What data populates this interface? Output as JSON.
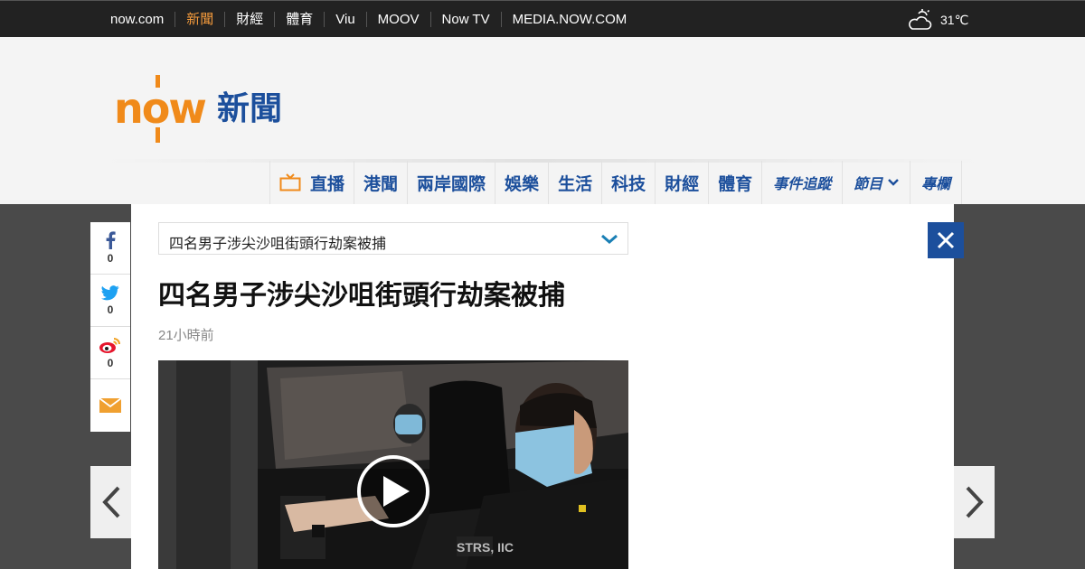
{
  "topnav": {
    "items": [
      "now.com",
      "新聞",
      "財經",
      "體育",
      "Viu",
      "MOOV",
      "Now TV",
      "MEDIA.NOW.COM"
    ]
  },
  "weather": {
    "icon": "cloudy-icon",
    "temp": "31℃"
  },
  "logo": {
    "brand": "now",
    "section": "新聞"
  },
  "mainnav": {
    "items": [
      "直播",
      "港聞",
      "兩岸國際",
      "娛樂",
      "生活",
      "科技",
      "財經",
      "體育",
      "事件追蹤",
      "節目",
      "專欄"
    ]
  },
  "share": {
    "facebook_count": "0",
    "twitter_count": "0",
    "weibo_count": "0"
  },
  "article": {
    "dropdown_value": "四名男子涉尖沙咀街頭行劫案被捕",
    "title": "四名男子涉尖沙咀街頭行劫案被捕",
    "time": "21小時前"
  },
  "colors": {
    "brand_orange": "#f08a1a",
    "brand_blue": "#1c4f9c",
    "topbar": "#222222"
  }
}
